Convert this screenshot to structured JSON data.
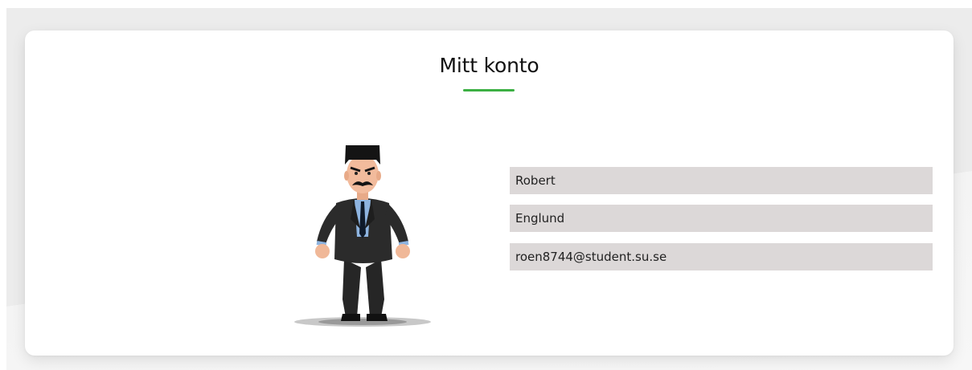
{
  "page": {
    "title": "Mitt konto",
    "accent_color": "#3cb043"
  },
  "profile": {
    "avatar_icon": "avatar-character",
    "first_name": "Robert",
    "last_name": "Englund",
    "email": "roen8744@student.su.se",
    "field_background": "#dcd8d8"
  }
}
